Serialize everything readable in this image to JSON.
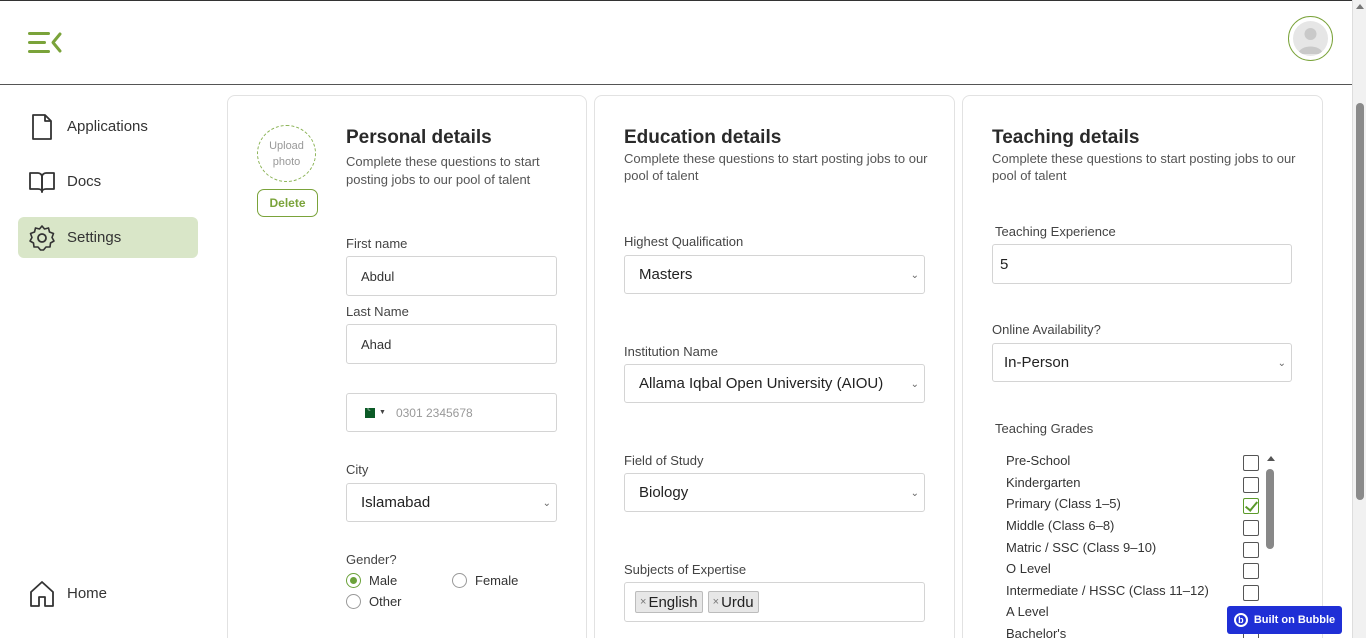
{
  "header": {
    "menu_icon": "menu-collapse-icon",
    "avatar_icon": "user-icon"
  },
  "sidebar": {
    "items": [
      {
        "label": "Applications",
        "icon": "file-icon"
      },
      {
        "label": "Docs",
        "icon": "book-icon"
      },
      {
        "label": "Settings",
        "icon": "gear-icon"
      }
    ],
    "home": {
      "label": "Home",
      "icon": "home-icon"
    }
  },
  "personal": {
    "title": "Personal details",
    "subtitle": "Complete these questions to start posting jobs to our pool of talent",
    "upload_label": "Upload photo",
    "delete_label": "Delete",
    "first_name_label": "First name",
    "first_name_value": "Abdul",
    "last_name_label": "Last Name",
    "last_name_value": "Ahad",
    "phone_placeholder": "0301 2345678",
    "city_label": "City",
    "city_value": "Islamabad",
    "gender_label": "Gender?",
    "gender_options": [
      "Male",
      "Female",
      "Other"
    ],
    "gender_selected": "Male"
  },
  "education": {
    "title": "Education details",
    "subtitle": "Complete these questions to start posting jobs to our pool of talent",
    "qualification_label": "Highest Qualification",
    "qualification_value": "Masters",
    "institution_label": "Institution Name",
    "institution_value": "Allama Iqbal Open University (AIOU)",
    "field_label": "Field of Study",
    "field_value": "Biology",
    "subjects_label": "Subjects of Expertise",
    "subjects": [
      "English",
      "Urdu"
    ]
  },
  "teaching": {
    "title": "Teaching details",
    "subtitle": "Complete these questions to start posting jobs to our pool of talent",
    "experience_label": "Teaching Experience",
    "experience_value": "5",
    "availability_label": "Online Availability?",
    "availability_value": "In-Person",
    "grades_label": "Teaching Grades",
    "grades": [
      {
        "label": "Pre-School",
        "checked": false
      },
      {
        "label": "Kindergarten",
        "checked": false
      },
      {
        "label": "Primary (Class 1–5)",
        "checked": true
      },
      {
        "label": "Middle (Class 6–8)",
        "checked": false
      },
      {
        "label": "Matric / SSC (Class 9–10)",
        "checked": false
      },
      {
        "label": "O Level",
        "checked": false
      },
      {
        "label": "Intermediate / HSSC (Class 11–12)",
        "checked": false
      },
      {
        "label": "A Level",
        "checked": false
      },
      {
        "label": "Bachelor's",
        "checked": false
      }
    ]
  },
  "badge": {
    "label": "Built on Bubble"
  },
  "colors": {
    "accent": "#7aa33a",
    "active_nav": "#d9e6c8",
    "badge": "#1f2fd6"
  }
}
